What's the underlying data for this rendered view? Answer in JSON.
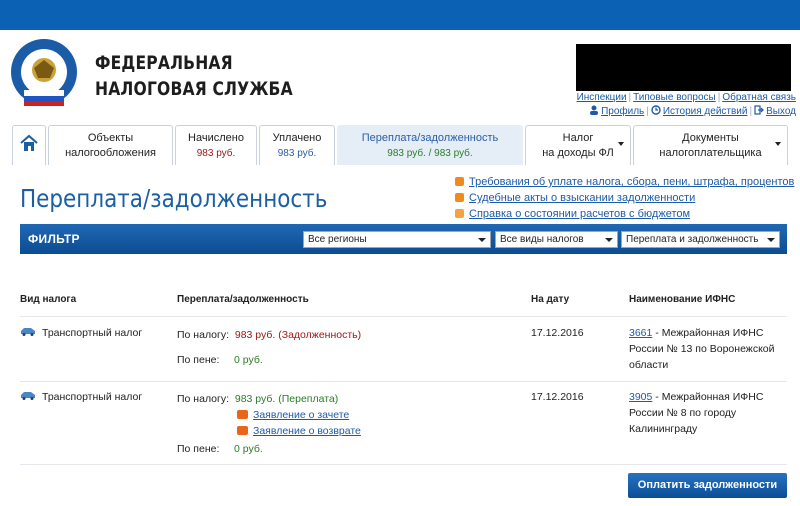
{
  "header": {
    "brand_line1": "ФЕДЕРАЛЬНАЯ",
    "brand_line2": "НАЛОГОВАЯ СЛУЖБА",
    "links_row1": [
      "Инспекции",
      "Типовые вопросы",
      "Обратная связь"
    ],
    "links_row2": [
      "Профиль",
      "История действий",
      "Выход"
    ]
  },
  "tabs": [
    {
      "label": "",
      "sub": "",
      "icon": "home-icon"
    },
    {
      "label": "Объекты",
      "sub_label": "налогообложения"
    },
    {
      "label": "Начислено",
      "sub": "983 руб."
    },
    {
      "label": "Уплачено",
      "sub": "983 руб."
    },
    {
      "label": "Переплата/задолженность",
      "sub": "983 руб. / 983 руб."
    },
    {
      "label": "Налог",
      "sub_label": "на доходы ФЛ"
    },
    {
      "label": "Документы",
      "sub_label": "налогоплательщика"
    }
  ],
  "page": {
    "title": "Переплата/задолженность",
    "side_links": [
      "Требования об уплате налога, сбора, пени, штрафа, процентов",
      "Судебные акты о взыскании задолженности",
      "Справка о состоянии расчетов с бюджетом"
    ]
  },
  "filter": {
    "label": "ФИЛЬТР",
    "region": "Все регионы",
    "tax_type": "Все виды налогов",
    "mode": "Переплата и задолженность"
  },
  "table": {
    "headers": [
      "Вид налога",
      "Переплата/задолженность",
      "На дату",
      "Наименование ИФНС"
    ],
    "rows": [
      {
        "tax": "Транспортный налог",
        "by_tax_label": "По налогу:",
        "by_tax_value": "983 руб. (Задолженность)",
        "penalty_label": "По пене:",
        "penalty_value": "0 руб.",
        "date": "17.12.2016",
        "ifns_code": "3661",
        "ifns_name_1": " - Межрайонная ИФНС",
        "ifns_name_2": "России № 13 по Воронежской",
        "ifns_name_3": "области"
      },
      {
        "tax": "Транспортный налог",
        "by_tax_label": "По налогу:",
        "by_tax_value": "983 руб. (Переплата)",
        "action1": "Заявление о зачете",
        "action2": "Заявление о возврате",
        "penalty_label": "По пене:",
        "penalty_value": "0 руб.",
        "date": "17.12.2016",
        "ifns_code": "3905",
        "ifns_name_1": " - Межрайонная ИФНС",
        "ifns_name_2": "России № 8 по городу",
        "ifns_name_3": "Калининграду"
      }
    ]
  },
  "pay_button": "Оплатить задолженности",
  "colors": {
    "brand_blue": "#0b61b3",
    "debt_red": "#a01717",
    "overpay_green": "#2a7d2a"
  }
}
